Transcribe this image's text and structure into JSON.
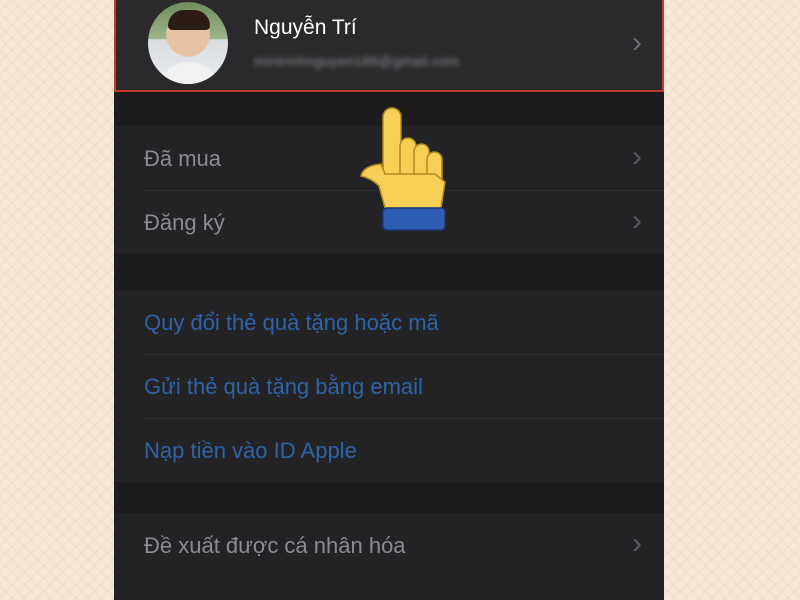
{
  "profile": {
    "name": "Nguyễn Trí",
    "email": "mintrinhnguyen188@gmail.com"
  },
  "section1": {
    "items": [
      {
        "label": "Đã mua"
      },
      {
        "label": "Đăng ký"
      }
    ]
  },
  "section2": {
    "items": [
      {
        "label": "Quy đổi thẻ quà tặng hoặc mã"
      },
      {
        "label": "Gửi thẻ quà tặng bằng email"
      },
      {
        "label": "Nạp tiền vào ID Apple"
      }
    ]
  },
  "section3": {
    "items": [
      {
        "label": "Đề xuất được cá nhân hóa"
      }
    ]
  },
  "icons": {
    "chevron": "chevron-right-icon",
    "pointer": "pointing-hand-icon"
  },
  "colors": {
    "highlight_border": "#c0392b",
    "link": "#2f63a8",
    "background": "#1c1c1e"
  }
}
